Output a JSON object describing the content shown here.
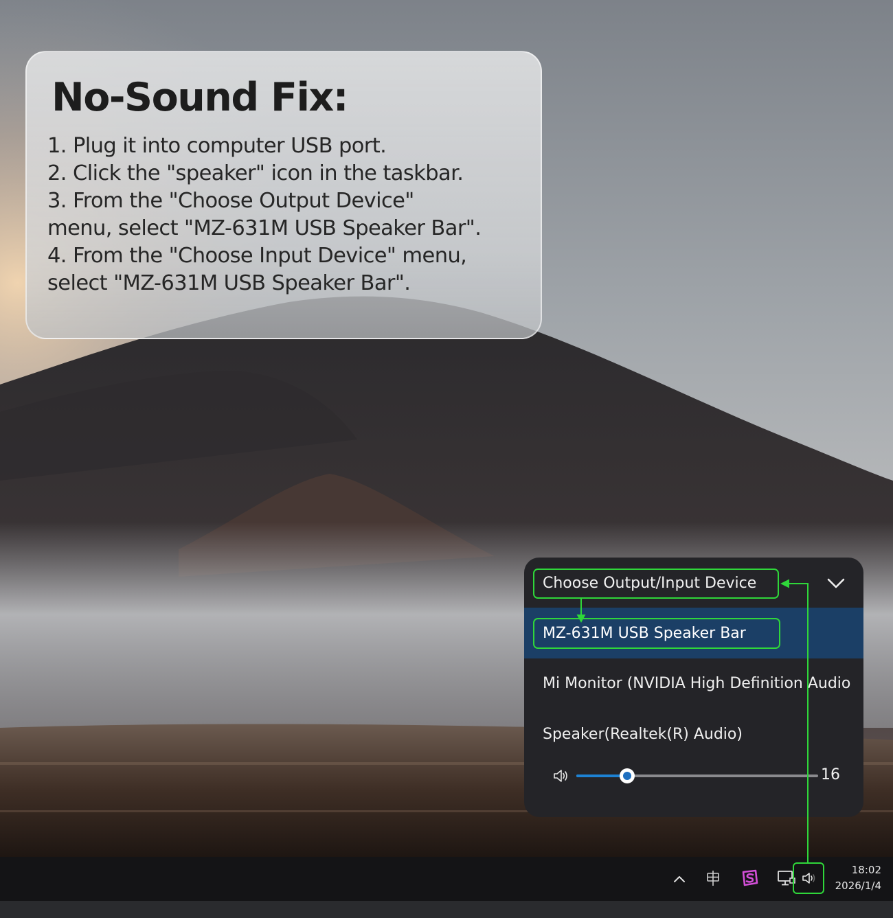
{
  "instruction_card": {
    "title": "No-Sound Fix:",
    "steps": [
      "1. Plug it into computer USB port.",
      "2. Click the \"speaker\" icon in the taskbar.",
      "3. From the \"Choose Output Device\"",
      "menu, select \"MZ-631M USB Speaker Bar\".",
      "4. From the \"Choose Input Device\" menu,",
      "select \"MZ-631M USB Speaker Bar\"."
    ]
  },
  "audio_flyout": {
    "header": "Choose Output/Input Device",
    "devices": [
      "MZ-631M USB Speaker Bar",
      "Mi Monitor (NVIDIA High Definition Audio",
      "Speaker(Realtek(R) Audio)"
    ],
    "selected_device": "MZ-631M USB Speaker Bar",
    "volume": {
      "value": "16",
      "level_fraction": 0.21
    }
  },
  "taskbar": {
    "tray_icons": [
      "chevron-up-icon",
      "language-input-icon",
      "app-s-icon",
      "display-icon",
      "speaker-icon"
    ],
    "clock_time": "18:02",
    "clock_date": "2026/1/4"
  },
  "colors": {
    "highlight_green": "#2fd73a",
    "flyout_bg": "#242428",
    "selected_row": "#1b3f66",
    "slider_blue": "#1d82d4",
    "app_icon_magenta": "#d44fd8"
  }
}
